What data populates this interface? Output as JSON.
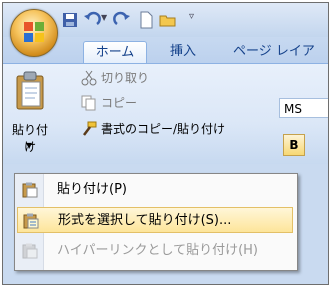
{
  "tabs": {
    "home": "ホーム",
    "insert": "挿入",
    "page_layout": "ページ レイア"
  },
  "ribbon": {
    "paste_label": "貼り付け",
    "cut": "切り取り",
    "copy": "コピー",
    "format_painter": "書式のコピー/貼り付け",
    "font_name": "MS",
    "bold": "B"
  },
  "menu": {
    "items": [
      {
        "label": "貼り付け(P)",
        "state": "normal"
      },
      {
        "label": "形式を選択して貼り付け(S)...",
        "state": "hover"
      },
      {
        "label": "ハイパーリンクとして貼り付け(H)",
        "state": "disabled"
      }
    ]
  },
  "colors": {
    "accent": "#15428b",
    "hover": "#fde59a",
    "ribbon_bg": "#dbe7f7"
  }
}
